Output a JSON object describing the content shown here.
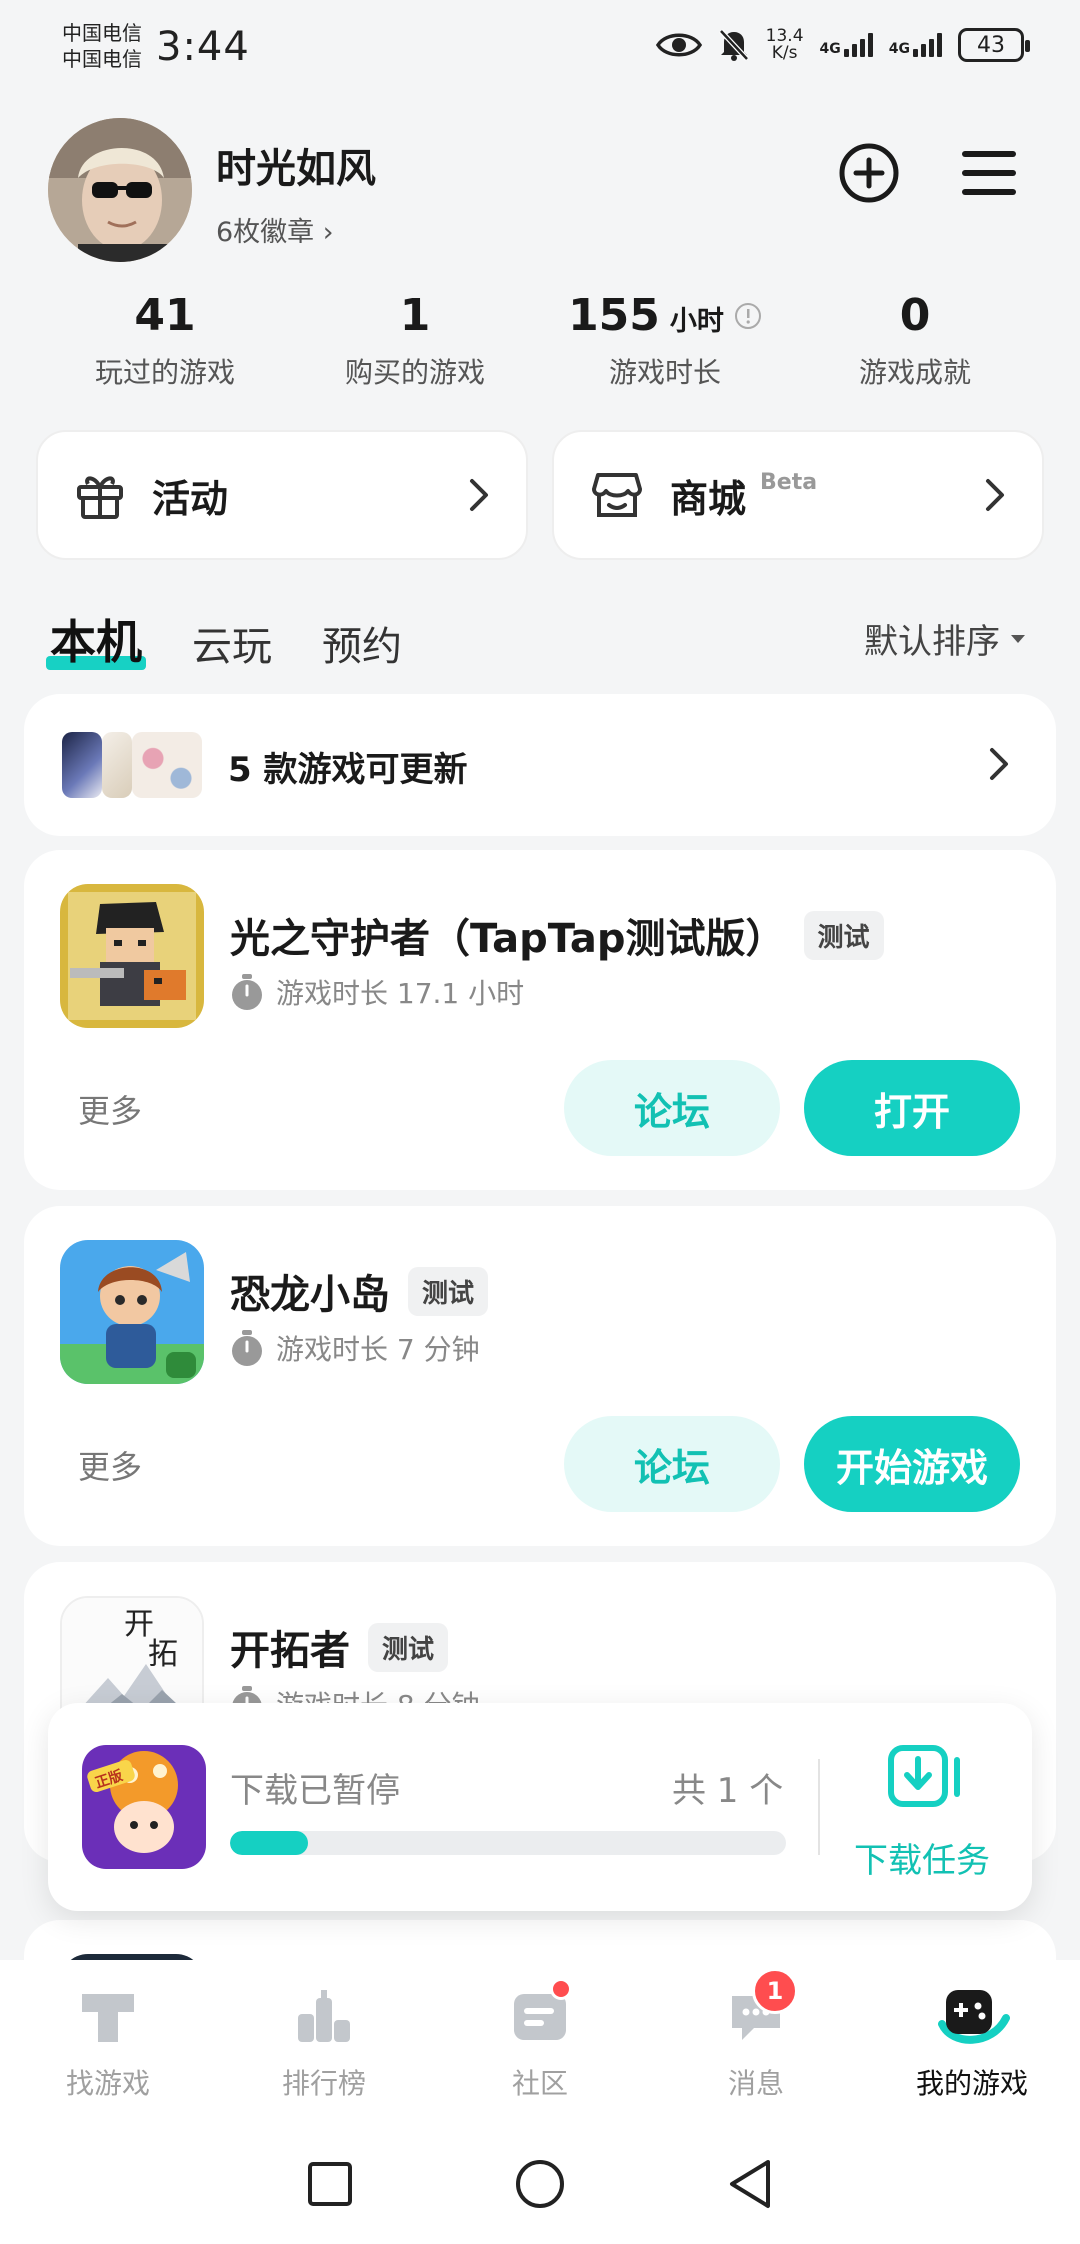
{
  "status_bar": {
    "carrier1": "中国电信",
    "carrier2": "中国电信",
    "time": "3:44",
    "speed_value": "13.4",
    "speed_unit": "K/s",
    "network1": "4G",
    "network2": "4G",
    "battery": "43"
  },
  "profile": {
    "username": "时光如风",
    "badges": "6枚徽章 ›"
  },
  "stats": [
    {
      "value": "41",
      "unit": "",
      "label": "玩过的游戏"
    },
    {
      "value": "1",
      "unit": "",
      "label": "购买的游戏"
    },
    {
      "value": "155",
      "unit": "小时",
      "label": "游戏时长"
    },
    {
      "value": "0",
      "unit": "",
      "label": "游戏成就"
    }
  ],
  "entries": {
    "activity": "活动",
    "mall": "商城",
    "mall_badge": "Beta"
  },
  "tabs": {
    "local": "本机",
    "cloud": "云玩",
    "reserve": "预约",
    "sort": "默认排序"
  },
  "update_banner": "5 款游戏可更新",
  "games": [
    {
      "name": "光之守护者（TapTap测试版）",
      "tag": "测试",
      "playtime": "游戏时长 17.1 小时",
      "more": "更多",
      "forum": "论坛",
      "action": "打开"
    },
    {
      "name": "恐龙小岛",
      "tag": "测试",
      "playtime": "游戏时长 7 分钟",
      "more": "更多",
      "forum": "论坛",
      "action": "开始游戏"
    },
    {
      "name": "开拓者",
      "tag": "测试",
      "playtime": "游戏时长 8 分钟"
    }
  ],
  "download": {
    "status": "下载已暂停",
    "count": "共 1 个",
    "progress": 0.14,
    "task_label": "下载任务"
  },
  "nav": {
    "find": "找游戏",
    "rank": "排行榜",
    "community": "社区",
    "messages": "消息",
    "messages_badge": "1",
    "my_games": "我的游戏"
  },
  "colors": {
    "accent": "#15d0c2",
    "accent_light": "#e4f9f7",
    "badge": "#ff4d4f"
  }
}
